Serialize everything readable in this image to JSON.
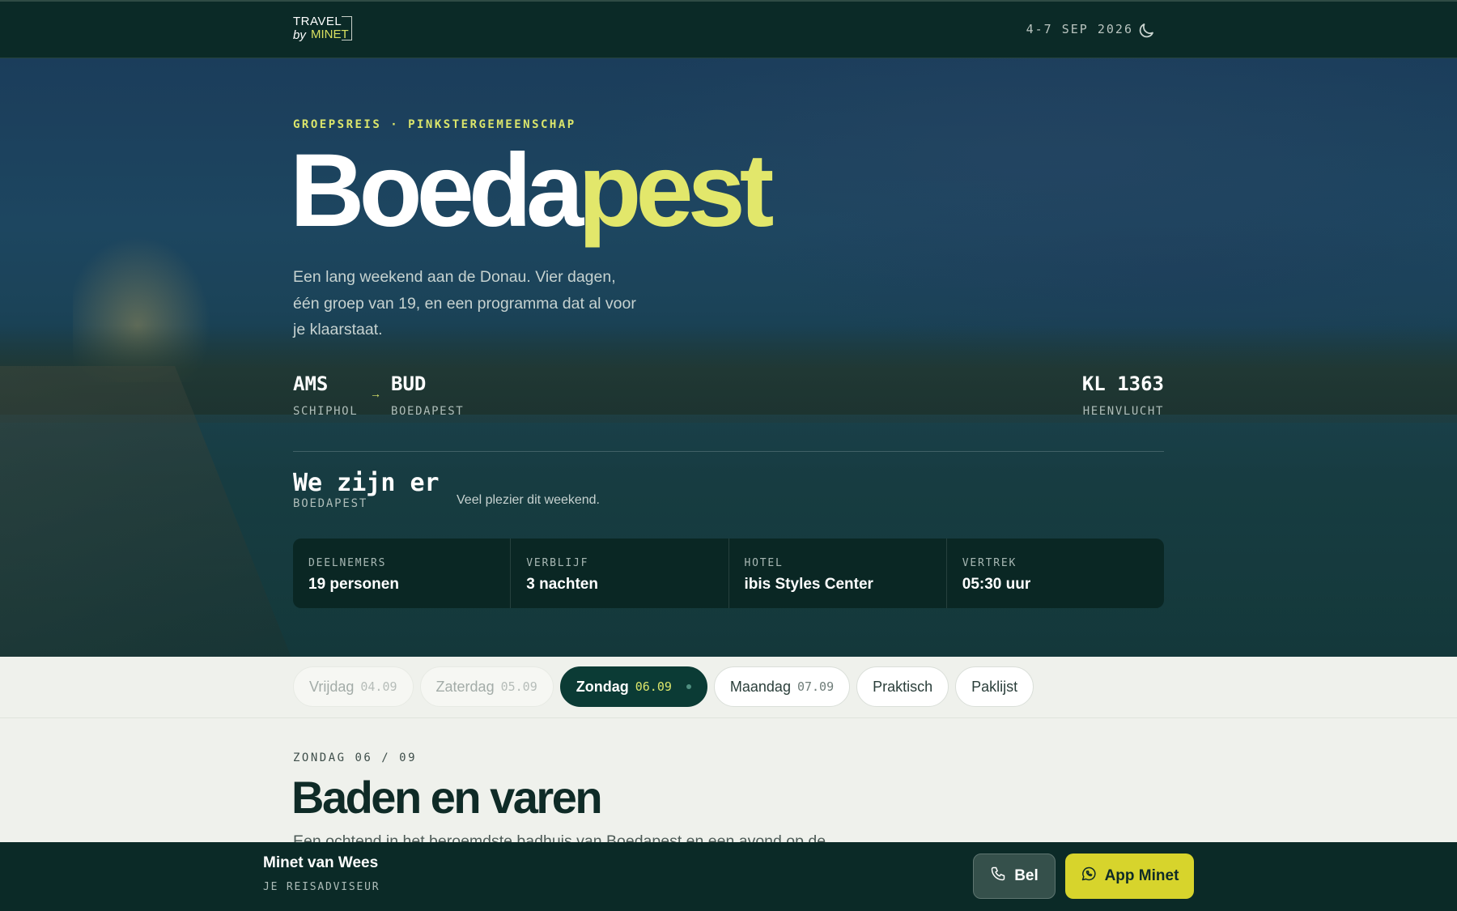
{
  "header": {
    "logo_line1": "TRAVEL",
    "logo_line2": "by",
    "logo_line3": "MINET",
    "dates": "4-7 SEP 2026",
    "theme_icon": "moon-icon"
  },
  "hero": {
    "eyebrow": "GROEPSREIS · PINKSTERGEMEENSCHAP",
    "title_part1": "Boeda",
    "title_part2": "pest",
    "intro": "Een lang weekend aan de Donau. Vier dagen, één groep van 19, en een programma dat al voor je klaarstaat.",
    "route": {
      "from_code": "AMS",
      "from_name": "SCHIPHOL",
      "arrow": "→",
      "to_code": "BUD",
      "to_name": "BOEDAPEST",
      "flight_code": "KL 1363",
      "flight_label": "HEENVLUCHT"
    },
    "status": {
      "title": "We zijn er",
      "location": "BOEDAPEST",
      "message": "Veel plezier dit weekend."
    },
    "stats": [
      {
        "label": "DEELNEMERS",
        "value": "19 personen"
      },
      {
        "label": "VERBLIJF",
        "value": "3 nachten"
      },
      {
        "label": "HOTEL",
        "value": "ibis Styles Center"
      },
      {
        "label": "VERTREK",
        "value": "05:30 uur"
      }
    ]
  },
  "tabs": [
    {
      "label": "Vrijdag",
      "date": "04.09",
      "state": "past"
    },
    {
      "label": "Zaterdag",
      "date": "05.09",
      "state": "past"
    },
    {
      "label": "Zondag",
      "date": "06.09",
      "state": "active"
    },
    {
      "label": "Maandag",
      "date": "07.09",
      "state": "upcoming"
    },
    {
      "label": "Praktisch",
      "date": "",
      "state": "upcoming"
    },
    {
      "label": "Paklijst",
      "date": "",
      "state": "upcoming"
    }
  ],
  "day": {
    "eyebrow": "ZONDAG 06 / 09",
    "title": "Baden en varen",
    "description": "Een ochtend in het beroemdste badhuis van Boedapest en een avond op de"
  },
  "footer": {
    "agent_name": "Minet van Wees",
    "agent_role": "JE REISADVISEUR",
    "call_label": "Bel",
    "call_icon": "phone-icon",
    "app_label": "App Minet",
    "app_icon": "whatsapp-icon"
  },
  "colors": {
    "brand_dark": "#0b2a27",
    "accent_yellow": "#e2e76b",
    "button_yellow": "#d7d42c",
    "page_bg": "#eff1ec"
  }
}
